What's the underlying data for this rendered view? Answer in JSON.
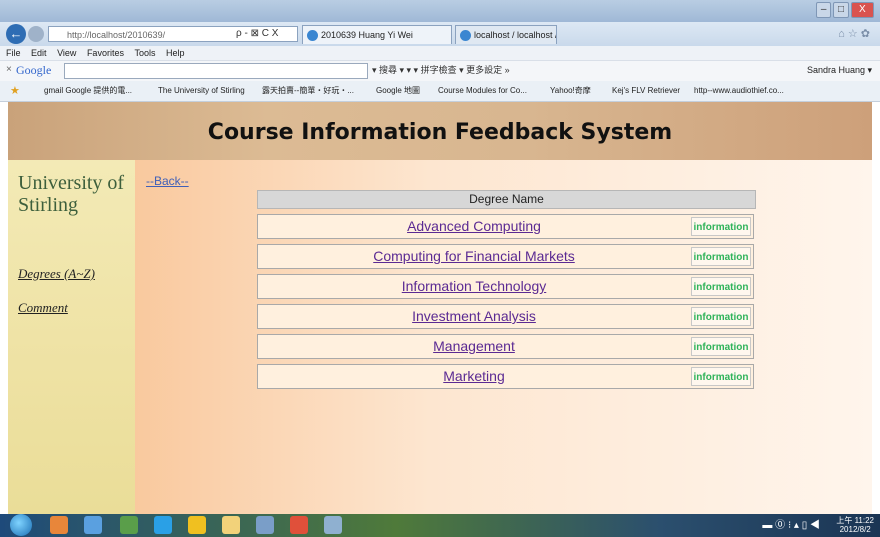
{
  "browser": {
    "window_controls": [
      "–",
      "□",
      "X"
    ],
    "address": "http://localhost/2010639/",
    "address_tools": "ρ - ⊠ C X",
    "tabs": [
      {
        "label": "2010639 Huang Yi Wei"
      },
      {
        "label": "localhost / localhost / test / f..."
      }
    ],
    "nav_icons": "⌂ ☆ ✿",
    "menu": [
      "File",
      "Edit",
      "View",
      "Favorites",
      "Tools",
      "Help"
    ],
    "google_toolbar": {
      "close": "×",
      "logo": "Google",
      "tools": "▾ 搜尋 ▾ ▾  ▾ 拼字檢查 ▾ 更多設定 »",
      "user": "Sandra Huang ▾"
    },
    "favorites": [
      "gmail Google 提供的電...",
      "The University of Stirling",
      "露天拍賣--簡單・好玩・...",
      "Google 地圖",
      "Course Modules for Co...",
      "Yahoo!奇摩",
      "Kej's FLV Retriever",
      "http--www.audiothief.co..."
    ]
  },
  "page": {
    "banner_title": "Course Information Feedback System",
    "sidebar": {
      "title": "University of Stirling",
      "degrees_link": "Degrees (A~Z)",
      "comment_link": "Comment"
    },
    "back_link": "--Back--",
    "table": {
      "header": "Degree Name",
      "rows": [
        {
          "name": "Advanced Computing",
          "info": "information"
        },
        {
          "name": "Computing for Financial Markets",
          "info": "information"
        },
        {
          "name": "Information Technology",
          "info": "information"
        },
        {
          "name": "Investment Analysis",
          "info": "information"
        },
        {
          "name": "Management",
          "info": "information"
        },
        {
          "name": "Marketing",
          "info": "information"
        }
      ]
    }
  },
  "taskbar": {
    "tray": "▬ ⓪ ⁝ ▴ ▯ ◀",
    "time": "上午 11:22",
    "date": "2012/8/2"
  }
}
